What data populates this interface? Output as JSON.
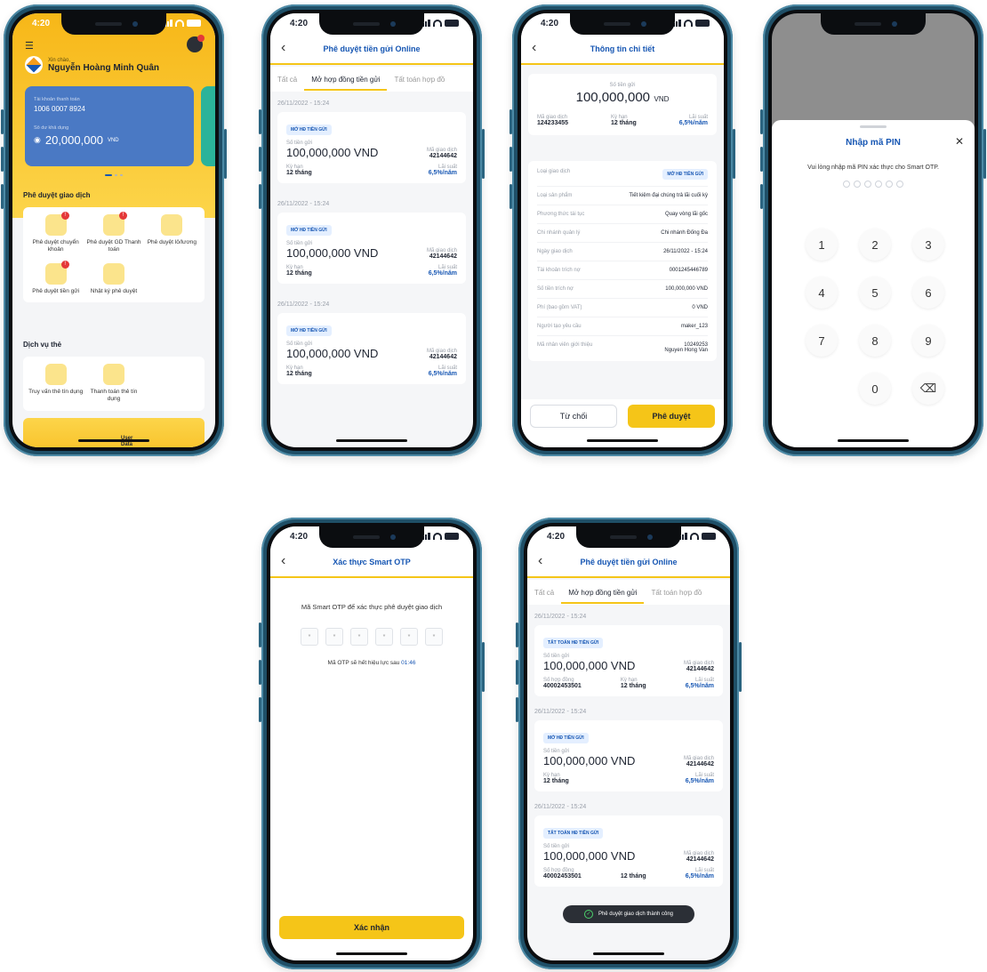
{
  "status_time": "4:20",
  "colors": {
    "accent": "#f5c518",
    "brand_blue": "#1656b3",
    "card_blue": "#4a79c4",
    "success": "#4cd36b"
  },
  "home": {
    "greeting": "Xin chào,",
    "user_name": "Nguyễn Hoàng Minh Quân",
    "account_label": "Tài khoản thanh toán",
    "account_number": "1006 0007 8924",
    "balance_label": "Số dư khả dụng",
    "balance": "20,000,000",
    "currency": "VND",
    "section_approve": "Phê duyệt giao dịch",
    "approve_items": [
      {
        "label": "Phê duyệt chuyển khoản",
        "badge": "!"
      },
      {
        "label": "Phê duyệt GD Thanh toán",
        "badge": "!"
      },
      {
        "label": "Phê duyệt lô/lương",
        "badge": ""
      },
      {
        "label": "Phê duyệt tiền gửi",
        "badge": "!"
      },
      {
        "label": "Nhật ký phê duyệt",
        "badge": ""
      }
    ],
    "section_card": "Dịch vụ thẻ",
    "card_items": [
      {
        "label": "Truy vấn thẻ tín dụng"
      },
      {
        "label": "Thanh toán thẻ tín dụng"
      }
    ],
    "banner_text": "User Data"
  },
  "list": {
    "title": "Phê duyệt tiền gửi Online",
    "tabs": [
      "Tất cả",
      "Mở hợp đồng tiền gửi",
      "Tất toán hợp đồ"
    ],
    "items": [
      {
        "date": "26/11/2022 - 15:24",
        "badge": "MỞ HĐ TIỀN GỬI",
        "amount_label": "Số tiền gửi",
        "amount": "100,000,000 VND",
        "txn_label": "Mã giao dịch",
        "txn": "42144642",
        "term_label": "Kỳ hạn",
        "term": "12 tháng",
        "rate_label": "Lãi suất",
        "rate": "6,5%/năm"
      },
      {
        "date": "26/11/2022 - 15:24",
        "badge": "MỞ HĐ TIỀN GỬI",
        "amount_label": "Số tiền gửi",
        "amount": "100,000,000 VND",
        "txn_label": "Mã giao dịch",
        "txn": "42144642",
        "term_label": "Kỳ hạn",
        "term": "12 tháng",
        "rate_label": "Lãi suất",
        "rate": "6,5%/năm"
      },
      {
        "date": "26/11/2022 - 15:24",
        "badge": "MỞ HĐ TIỀN GỬI",
        "amount_label": "Số tiền gửi",
        "amount": "100,000,000 VND",
        "txn_label": "Mã giao dịch",
        "txn": "42144642",
        "term_label": "Kỳ hạn",
        "term": "12 tháng",
        "rate_label": "Lãi suất",
        "rate": "6,5%/năm"
      }
    ]
  },
  "detail": {
    "title": "Thông tin chi tiết",
    "amount_label": "Số tiền gửi",
    "amount": "100,000,000",
    "currency": "VND",
    "txn_label": "Mã giao dịch",
    "txn": "124233455",
    "term_label": "Kỳ hạn",
    "term": "12 tháng",
    "rate_label": "Lãi suất",
    "rate": "6,5%/năm",
    "rows": [
      {
        "label": "Loại giao dịch",
        "value": "MỞ HĐ TIỀN GỬI"
      },
      {
        "label": "Loại sản phẩm",
        "value": "Tiết kiệm đại chúng trả lãi cuối kỳ"
      },
      {
        "label": "Phương thức tái tục",
        "value": "Quay vòng lãi gốc"
      },
      {
        "label": "Chi nhánh quản lý",
        "value": "Chi nhánh Đống Đa"
      },
      {
        "label": "Ngày giao dịch",
        "value": "26/11/2022 - 15:24"
      },
      {
        "label": "Tài khoản trích nợ",
        "value": "0001245446789"
      },
      {
        "label": "Số tiền trích nợ",
        "value": "100,000,000 VND"
      },
      {
        "label": "Phí (bao gồm VAT)",
        "value": "0 VND"
      },
      {
        "label": "Người tạo yêu cầu",
        "value": "maker_123"
      },
      {
        "label": "Mã nhân viên giới thiệu",
        "value": "10249253",
        "value2": "Nguyen Hong Van"
      }
    ],
    "reject_label": "Từ chối",
    "approve_label": "Phê duyệt"
  },
  "pin": {
    "title": "Nhập mã PIN",
    "instruction": "Vui lòng nhập mã PIN xác thực cho Smart OTP.",
    "keys": [
      "1",
      "2",
      "3",
      "4",
      "5",
      "6",
      "7",
      "8",
      "9",
      "",
      "0",
      "⌫"
    ]
  },
  "otp": {
    "title": "Xác thực Smart OTP",
    "instruction": "Mã Smart OTP để xác thực phê duyệt giao dịch",
    "digit_mask": "*",
    "expiry_text": "Mã OTP sẽ hết hiệu lực sau",
    "expiry_time": "01:46",
    "confirm_label": "Xác nhận"
  },
  "result": {
    "title": "Phê duyệt tiền gửi Online",
    "tabs": [
      "Tất cả",
      "Mở hợp đồng tiền gửi",
      "Tất toán hợp đồ"
    ],
    "items": [
      {
        "date": "26/11/2022 - 15:24",
        "badge": "TẤT TOÁN HĐ TIỀN GỬI",
        "amount_label": "Số tiền gửi",
        "amount": "100,000,000 VND",
        "txn_label": "Mã giao dịch",
        "txn": "42144642",
        "c1_label": "Số hợp đồng",
        "c1": "40002453501",
        "term_label": "Kỳ hạn",
        "term": "12 tháng",
        "rate_label": "Lãi suất",
        "rate": "6,5%/năm"
      },
      {
        "date": "26/11/2022 - 15:24",
        "badge": "MỞ HĐ TIỀN GỬI",
        "amount_label": "Số tiền gửi",
        "amount": "100,000,000 VND",
        "txn_label": "Mã giao dịch",
        "txn": "42144642",
        "term_label": "Kỳ hạn",
        "term": "12 tháng",
        "rate_label": "Lãi suất",
        "rate": "6,5%/năm"
      },
      {
        "date": "26/11/2022 - 15:24",
        "badge": "TẤT TOÁN HĐ TIỀN GỬI",
        "amount_label": "Số tiền gửi",
        "amount": "100,000,000 VND",
        "txn_label": "Mã giao dịch",
        "txn": "42144642",
        "c1_label": "Số hợp đồng",
        "c1": "40002453501",
        "term": "12 tháng",
        "rate_label": "Lãi suất",
        "rate": "6,5%/năm"
      }
    ],
    "toast": "Phê duyệt giao dịch thành công"
  }
}
